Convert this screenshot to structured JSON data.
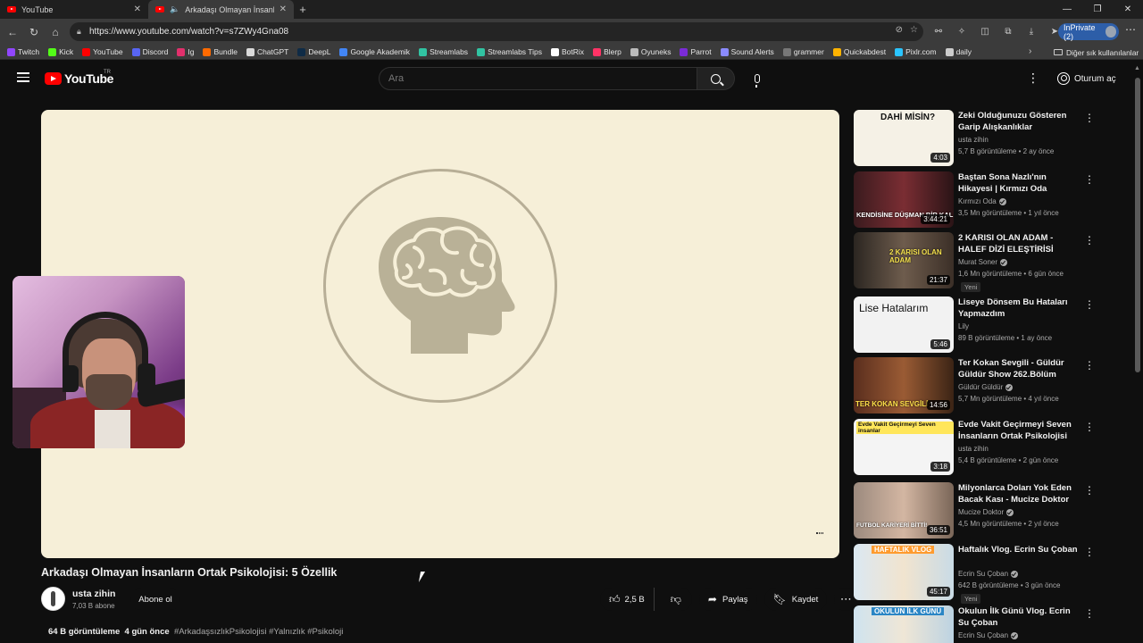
{
  "browser": {
    "tabs": [
      {
        "title": "YouTube"
      },
      {
        "title": "Arkadaşı Olmayan İnsanların"
      }
    ],
    "url": "https://www.youtube.com/watch?v=s7ZWy4Gna08",
    "inprivate_label": "InPrivate (2)",
    "bookmarks": [
      {
        "label": "Twitch",
        "color": "#9146ff"
      },
      {
        "label": "Kick",
        "color": "#53fc18"
      },
      {
        "label": "YouTube",
        "color": "#ff0000"
      },
      {
        "label": "Discord",
        "color": "#5865f2"
      },
      {
        "label": "Ig",
        "color": "#e1306c"
      },
      {
        "label": "Bundle",
        "color": "#ff6a00"
      },
      {
        "label": "ChatGPT",
        "color": "#d9d9d9"
      },
      {
        "label": "DeepL",
        "color": "#0f2b46"
      },
      {
        "label": "Google Akademik",
        "color": "#4285f4"
      },
      {
        "label": "Streamlabs",
        "color": "#31c3a2"
      },
      {
        "label": "Streamlabs Tips",
        "color": "#31c3a2"
      },
      {
        "label": "BotRix",
        "color": "#ffffff"
      },
      {
        "label": "Blerp",
        "color": "#ff3366"
      },
      {
        "label": "Oyuneks",
        "color": "#bbbbbb"
      },
      {
        "label": "Parrot",
        "color": "#7a2bd6"
      },
      {
        "label": "Sound Alerts",
        "color": "#8b8bff"
      },
      {
        "label": "grammer",
        "color": "#777777"
      },
      {
        "label": "Quickabdest",
        "color": "#ffb300"
      },
      {
        "label": "Pixlr.com",
        "color": "#2ac4ff"
      },
      {
        "label": "daily",
        "color": "#cccccc"
      }
    ],
    "other_bookmarks": "Diğer sık kullanılanlar"
  },
  "youtube": {
    "logo_text": "YouTube",
    "region": "TR",
    "search_placeholder": "Ara",
    "signin_label": "Oturum aç"
  },
  "video": {
    "title": "Arkadaşı Olmayan İnsanların Ortak Psikolojisi: 5 Özellik",
    "channel": "usta zihin",
    "subscribers": "7,03 B abone",
    "subscribe_label": "Abone ol",
    "likes": "2,5 B",
    "share_label": "Paylaş",
    "save_label": "Kaydet",
    "views": "64 B görüntüleme",
    "date": "4 gün önce",
    "tags": "#ArkadaşsızlıkPsikolojisi #Yalnızlık #Psikoloji",
    "player_bg": "#f6efd8"
  },
  "recommendations": [
    {
      "title": "Zeki Olduğunuzu Gösteren Garip Alışkanlıklar",
      "channel": "usta zihin",
      "verified": false,
      "meta": "5,7 B görüntüleme • 2 ay önce",
      "duration": "4:03",
      "thumb_text": "DAHİ MİSİN?",
      "new": false
    },
    {
      "title": "Baştan Sona Nazlı'nın Hikayesi | Kırmızı Oda",
      "channel": "Kırmızı Oda",
      "verified": true,
      "meta": "3,5 Mn görüntüleme • 1 yıl önce",
      "duration": "3:44:21",
      "thumb_text": "KENDİSİNE DÜŞMAN BİR KAL",
      "new": false
    },
    {
      "title": "2 KARISI OLAN ADAM - HALEF DİZİ ELEŞTİRİSİ",
      "channel": "Murat Soner",
      "verified": true,
      "meta": "1,6 Mn görüntüleme • 6 gün önce",
      "duration": "21:37",
      "thumb_text": "2 KARISI OLAN ADAM",
      "new": true,
      "new_label": "Yeni"
    },
    {
      "title": "Liseye Dönsem Bu Hataları Yapmazdım",
      "channel": "Lily",
      "verified": false,
      "meta": "89 B görüntüleme • 1 ay önce",
      "duration": "5:46",
      "thumb_text": "Lise Hatalarım",
      "new": false
    },
    {
      "title": "Ter Kokan Sevgili - Güldür Güldür Show 262.Bölüm",
      "channel": "Güldür Güldür",
      "verified": true,
      "meta": "5,7 Mn görüntüleme • 4 yıl önce",
      "duration": "14:56",
      "thumb_text": "TER KOKAN SEVGİLİ",
      "new": false
    },
    {
      "title": "Evde Vakit Geçirmeyi Seven İnsanların Ortak Psikolojisi",
      "channel": "usta zihin",
      "verified": false,
      "meta": "5,4 B görüntüleme • 2 gün önce",
      "duration": "3:18",
      "thumb_text": "Evde Vakit Geçirmeyi Seven insanlar",
      "new": false
    },
    {
      "title": "Milyonlarca Doları Yok Eden Bacak Kası - Mucize Doktor",
      "channel": "Mucize Doktor",
      "verified": true,
      "meta": "4,5 Mn görüntüleme • 2 yıl önce",
      "duration": "36:51",
      "thumb_text": "FUTBOL KARİYERİ BİTTİ!",
      "new": false
    },
    {
      "title": "Haftalık Vlog. Ecrin Su Çoban",
      "channel": "Ecrin Su Çoban",
      "verified": true,
      "meta": "642 B görüntüleme • 3 gün önce",
      "duration": "45:17",
      "thumb_text": "HAFTALIK VLOG",
      "new": true,
      "new_label": "Yeni"
    },
    {
      "title": "Okulun İlk Günü Vlog. Ecrin Su Çoban",
      "channel": "Ecrin Su Çoban",
      "verified": true,
      "meta": "",
      "duration": "",
      "thumb_text": "OKULUN İLK GÜNÜ",
      "new": false
    }
  ]
}
